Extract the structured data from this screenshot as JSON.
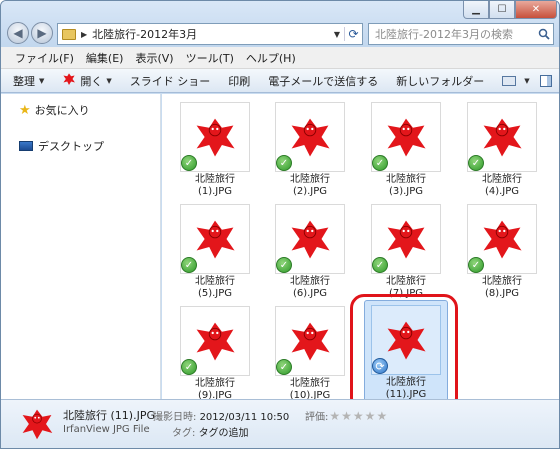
{
  "window": {
    "address": "北陸旅行-2012年3月",
    "search_placeholder": "北陸旅行-2012年3月の検索"
  },
  "menubar": [
    "ファイル(F)",
    "編集(E)",
    "表示(V)",
    "ツール(T)",
    "ヘルプ(H)"
  ],
  "toolbar": {
    "organize": "整理",
    "open": "開く",
    "slideshow": "スライド ショー",
    "print": "印刷",
    "email": "電子メールで送信する",
    "new_folder": "新しいフォルダー"
  },
  "navpane": {
    "favorites": "お気に入り",
    "desktop": "デスクトップ"
  },
  "files": [
    {
      "line1": "北陸旅行",
      "line2": "(1).JPG",
      "status": "ok"
    },
    {
      "line1": "北陸旅行",
      "line2": "(2).JPG",
      "status": "ok"
    },
    {
      "line1": "北陸旅行",
      "line2": "(3).JPG",
      "status": "ok"
    },
    {
      "line1": "北陸旅行",
      "line2": "(4).JPG",
      "status": "ok"
    },
    {
      "line1": "北陸旅行",
      "line2": "(5).JPG",
      "status": "ok"
    },
    {
      "line1": "北陸旅行",
      "line2": "(6).JPG",
      "status": "ok"
    },
    {
      "line1": "北陸旅行",
      "line2": "(7).JPG",
      "status": "ok"
    },
    {
      "line1": "北陸旅行",
      "line2": "(8).JPG",
      "status": "ok"
    },
    {
      "line1": "北陸旅行",
      "line2": "(9).JPG",
      "status": "ok"
    },
    {
      "line1": "北陸旅行",
      "line2": "(10).JPG",
      "status": "ok"
    },
    {
      "line1": "北陸旅行",
      "line2": "(11).JPG",
      "status": "sync"
    }
  ],
  "details": {
    "name": "北陸旅行 (11).JPG",
    "type": "IrfanView JPG File",
    "date_label": "撮影日時:",
    "date_value": "2012/03/11 10:50",
    "tag_label": "タグ:",
    "tag_value": "タグの追加",
    "rating_label": "評価:",
    "rating_stars": 0
  },
  "colors": {
    "accent": "#e0141a",
    "icon_red": "#e3161b",
    "selection": "#cfe4fa"
  }
}
